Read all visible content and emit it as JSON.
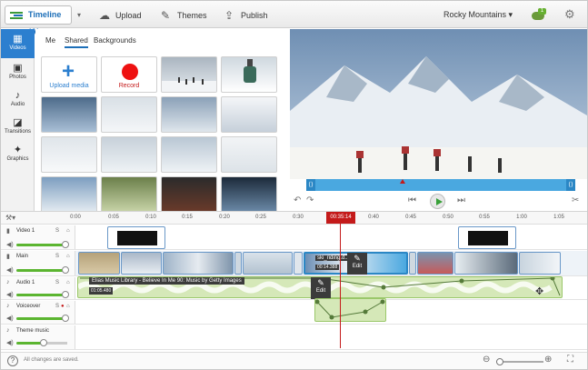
{
  "topbar": {
    "timeline_label": "Timeline (A)",
    "upload_label": "Upload",
    "themes_label": "Themes",
    "publish_label": "Publish",
    "project_name": "Rocky Mountains ▾",
    "notification_count": "1"
  },
  "sidenav": {
    "items": [
      {
        "label": "Videos",
        "icon": "film-icon",
        "active": true
      },
      {
        "label": "Photos",
        "icon": "photo-icon"
      },
      {
        "label": "Audio",
        "icon": "music-note-icon"
      },
      {
        "label": "Transitions",
        "icon": "transitions-icon"
      },
      {
        "label": "Graphics",
        "icon": "graphics-icon"
      }
    ]
  },
  "media": {
    "tabs": [
      "Me",
      "Shared",
      "Backgrounds"
    ],
    "active_tab": "Shared",
    "upload_label": "Upload media",
    "record_label": "Record"
  },
  "timeline": {
    "ticks": [
      "0:00",
      "0:05",
      "0:10",
      "0:15",
      "0:20",
      "0:25",
      "0:30",
      "0:40",
      "0:45",
      "0:50",
      "0:55",
      "1:00",
      "1:05"
    ],
    "playhead_time": "00:35:14",
    "tracks": [
      {
        "name": "Video 1"
      },
      {
        "name": "Main"
      },
      {
        "name": "Audio 1"
      },
      {
        "name": "Voiceover"
      },
      {
        "name": "Theme music"
      }
    ],
    "clip_label": "ski_riding.d...",
    "clip_time": "00:14.388",
    "audio_title": "Elias Music Library - Believe In Me 90: Music by Getty Images",
    "audio_time": "01:05.480",
    "edit_label": "Edit"
  },
  "footer": {
    "status": "All changes are saved."
  },
  "colors": {
    "accent": "#2c7fcf",
    "record": "#ee1111",
    "playhead": "#c41a1a",
    "audio": "#d5e8b8"
  }
}
